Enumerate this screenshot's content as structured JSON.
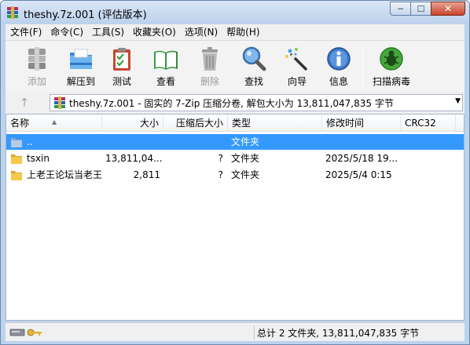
{
  "window": {
    "title": "theshy.7z.001 (评估版本)",
    "minimize_glyph": "─",
    "maximize_glyph": "☐",
    "close_glyph": "✕"
  },
  "menu": [
    "文件(F)",
    "命令(C)",
    "工具(S)",
    "收藏夹(O)",
    "选项(N)",
    "帮助(H)"
  ],
  "toolbar": {
    "add": {
      "label": "添加",
      "icon": "add-archive-icon",
      "enabled": false
    },
    "extract": {
      "label": "解压到",
      "icon": "extract-folder-icon",
      "enabled": true
    },
    "test": {
      "label": "测试",
      "icon": "test-clipboard-icon",
      "enabled": true
    },
    "view": {
      "label": "查看",
      "icon": "book-view-icon",
      "enabled": true
    },
    "delete": {
      "label": "删除",
      "icon": "trash-can-icon",
      "enabled": false
    },
    "find": {
      "label": "查找",
      "icon": "magnifier-icon",
      "enabled": true
    },
    "wizard": {
      "label": "向导",
      "icon": "magic-wand-icon",
      "enabled": true
    },
    "info": {
      "label": "信息",
      "icon": "info-icon",
      "enabled": true
    },
    "scan": {
      "label": "扫描病毒",
      "icon": "virus-scan-icon",
      "enabled": true
    }
  },
  "address": {
    "up_glyph": "🡑",
    "text": "theshy.7z.001 - 固实的 7-Zip 压缩分卷, 解包大小为 13,811,047,835 字节",
    "dropdown_glyph": "▼"
  },
  "columns": {
    "name": "名称",
    "size": "大小",
    "packed": "压缩后大小",
    "type": "类型",
    "modified": "修改时间",
    "crc": "CRC32",
    "sort_glyph": "▲"
  },
  "rows": [
    {
      "name": "..",
      "size": "",
      "packed": "",
      "type": "文件夹",
      "modified": "",
      "crc": "",
      "selected": true,
      "icon": "folder-up-icon"
    },
    {
      "name": "tsxin",
      "size": "13,811,04...",
      "packed": "?",
      "type": "文件夹",
      "modified": "2025/5/18 19...",
      "crc": "",
      "selected": false,
      "icon": "folder-icon"
    },
    {
      "name": "上老王论坛当老王",
      "size": "2,811",
      "packed": "?",
      "type": "文件夹",
      "modified": "2025/5/4 0:15",
      "crc": "",
      "selected": false,
      "icon": "folder-icon"
    }
  ],
  "status": {
    "summary": "总计 2 文件夹, 13,811,047,835 字节"
  },
  "colors": {
    "selection": "#3399ff",
    "title_bar": "#bcd1ec"
  }
}
